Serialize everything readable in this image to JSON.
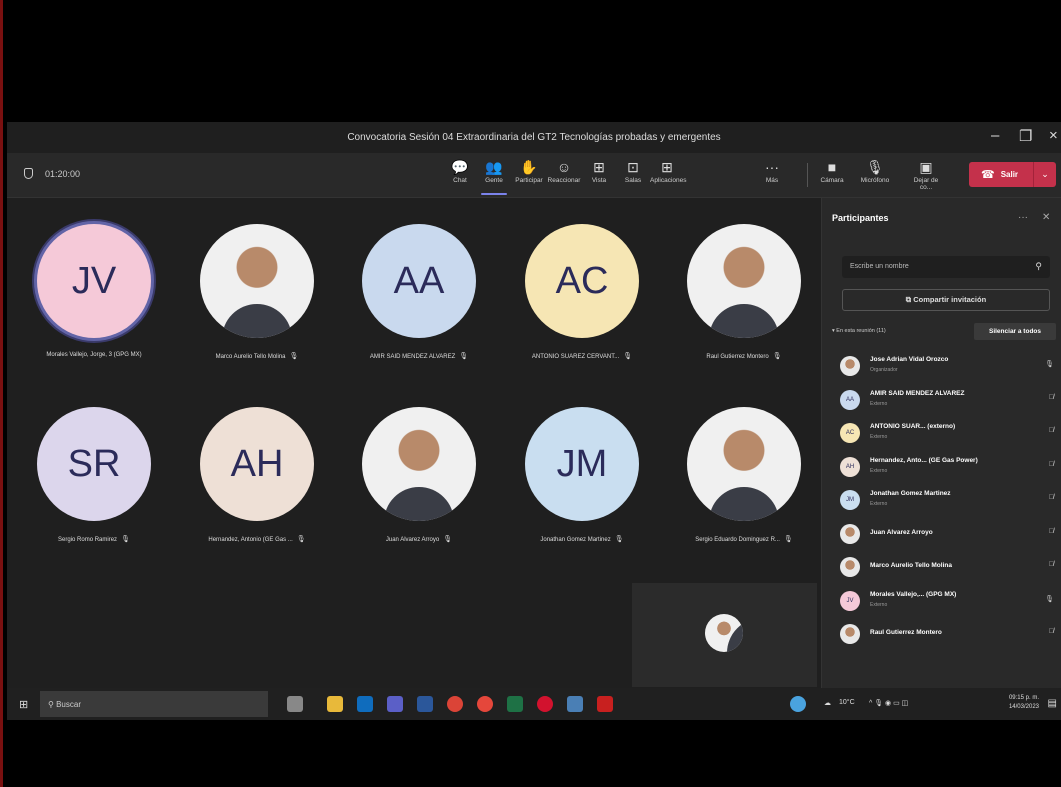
{
  "window": {
    "title": "Convocatoria Sesión 04 Extraordinaria del GT2 Tecnologías probadas y emergentes",
    "minimize": "–",
    "maximize": "❐",
    "close": "×"
  },
  "toolbar": {
    "timer": "01:20:00",
    "buttons": [
      {
        "label": "Chat",
        "icon": "💬"
      },
      {
        "label": "Gente",
        "icon": "👥"
      },
      {
        "label": "Participar",
        "icon": "✋"
      },
      {
        "label": "Reaccionar",
        "icon": "☺"
      },
      {
        "label": "Vista",
        "icon": "⊞"
      },
      {
        "label": "Salas",
        "icon": "⊡"
      },
      {
        "label": "Aplicaciones",
        "icon": "⊞"
      },
      {
        "label": "Más",
        "icon": "···"
      },
      {
        "label": "Cámara",
        "icon": "■"
      },
      {
        "label": "Micrófono",
        "icon": "🎙"
      },
      {
        "label": "Dejar de co...",
        "icon": "▣"
      }
    ],
    "leave_label": "Salir",
    "leave_color": "#c4314b"
  },
  "gallery": [
    {
      "initials": "JV",
      "name": "Morales Vallejo, Jorge, 3 (GPG MX)",
      "color": "#f5c9d8",
      "photo": false,
      "speaking": true
    },
    {
      "initials": "",
      "name": "Marco Aurelio Tello Molina",
      "color": "#e8e8e8",
      "photo": true
    },
    {
      "initials": "AA",
      "name": "AMIR SAID MENDEZ ALVAREZ",
      "color": "#c9d9ee",
      "photo": false
    },
    {
      "initials": "AC",
      "name": "ANTONIO SUAREZ CERVANT...",
      "color": "#f6e6b4",
      "photo": false
    },
    {
      "initials": "",
      "name": "Raul Gutierrez Montero",
      "color": "#e8e8e8",
      "photo": true
    },
    {
      "initials": "SR",
      "name": "Sergio Romo Ramirez",
      "color": "#dcd6ec",
      "photo": false
    },
    {
      "initials": "AH",
      "name": "Hernandez, Antonio (GE Gas ...",
      "color": "#eee0d6",
      "photo": false
    },
    {
      "initials": "",
      "name": "Juan Alvarez Arroyo",
      "color": "#e8e8e8",
      "photo": true
    },
    {
      "initials": "JM",
      "name": "Jonathan Gomez Martinez",
      "color": "#c9def0",
      "photo": false
    },
    {
      "initials": "",
      "name": "Sergio Eduardo Dominguez R...",
      "color": "#e8e8e8",
      "photo": true
    }
  ],
  "panel": {
    "title": "Participantes",
    "search_placeholder": "Escribe un nombre",
    "invite_label": "Compartir invitación",
    "in_meeting_label": "En esta reunión (11)",
    "mute_all_label": "Silenciar a todos",
    "participants": [
      {
        "initials": "",
        "name": "Jose Adrian Vidal Orozco",
        "sub": "Organizador",
        "color": "#b88a6a",
        "photo": true,
        "mic": "on"
      },
      {
        "initials": "AA",
        "name": "AMIR SAID MENDEZ ALVAREZ",
        "sub": "Externo",
        "color": "#c9d9ee",
        "photo": false,
        "mic": "off"
      },
      {
        "initials": "AC",
        "name": "ANTONIO SUAR...  (externo)",
        "sub": "Externo",
        "color": "#f6e6b4",
        "photo": false,
        "mic": "off"
      },
      {
        "initials": "AH",
        "name": "Hernandez, Anto... (GE Gas Power)",
        "sub": "Externo",
        "color": "#eee0d6",
        "photo": false,
        "mic": "off"
      },
      {
        "initials": "JM",
        "name": "Jonathan Gomez Martinez",
        "sub": "Externo",
        "color": "#c9def0",
        "photo": false,
        "mic": "off"
      },
      {
        "initials": "",
        "name": "Juan Alvarez Arroyo",
        "sub": "",
        "color": "#b88a6a",
        "photo": true,
        "mic": "off"
      },
      {
        "initials": "",
        "name": "Marco Aurelio Tello Molina",
        "sub": "",
        "color": "#b88a6a",
        "photo": true,
        "mic": "off"
      },
      {
        "initials": "JV",
        "name": "Morales Vallejo,... (GPG MX)",
        "sub": "Externo",
        "color": "#f5c9d8",
        "photo": false,
        "mic": "on"
      },
      {
        "initials": "",
        "name": "Raul Gutierrez Montero",
        "sub": "",
        "color": "#b88a6a",
        "photo": true,
        "mic": "off"
      }
    ]
  },
  "taskbar": {
    "search_placeholder": "Buscar",
    "weather": "10°C",
    "time": "09:15 p. m.",
    "date": "14/03/2023"
  }
}
